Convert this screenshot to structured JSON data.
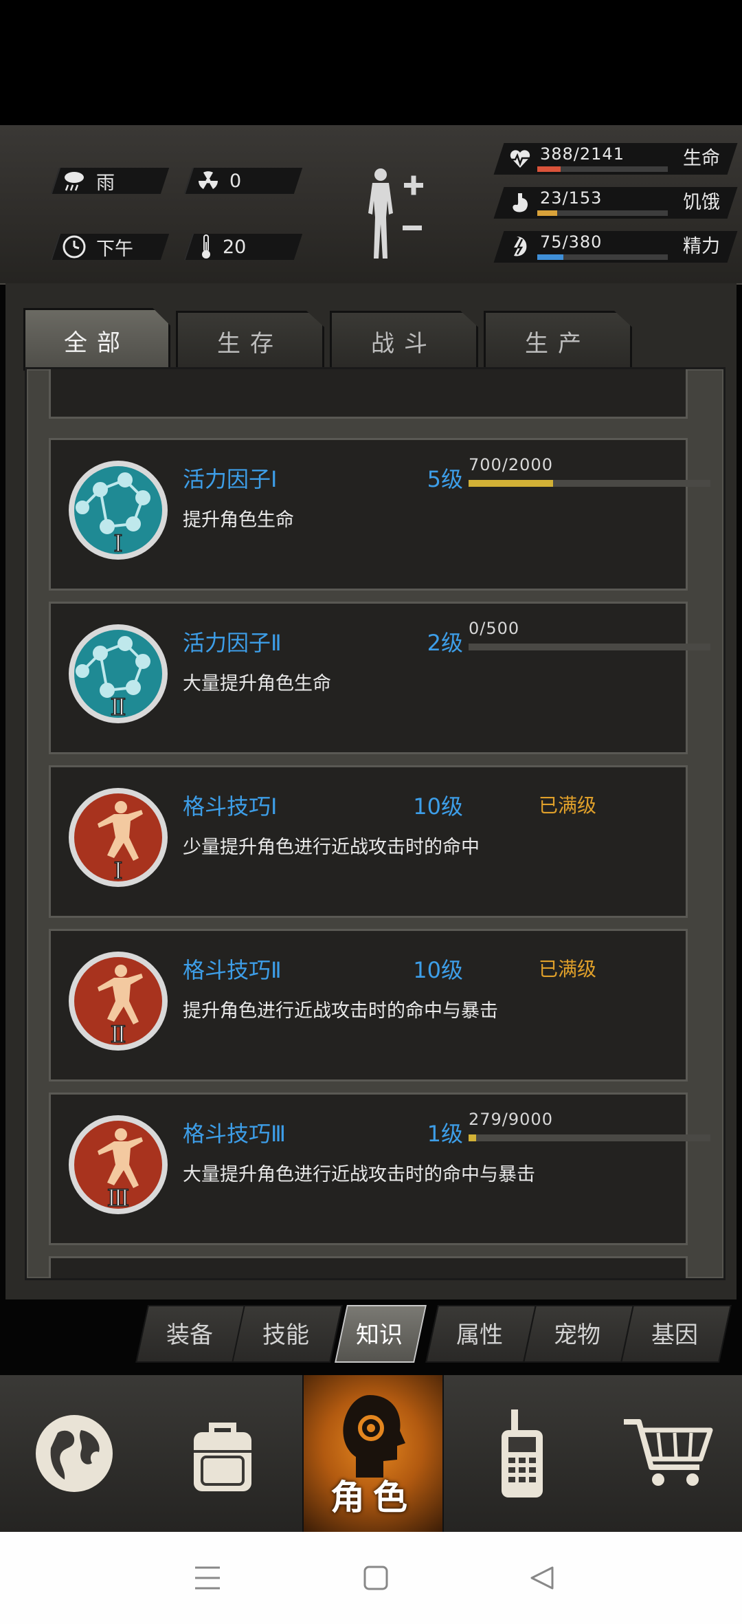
{
  "hud": {
    "weather": "雨",
    "radiation": "0",
    "time_of_day": "下午",
    "temperature": "20",
    "stats": [
      {
        "value": "388/2141",
        "label": "生命",
        "fill": 0.18,
        "color": "#d9533a",
        "icon": "heart-icon"
      },
      {
        "value": "23/153",
        "label": "饥饿",
        "fill": 0.15,
        "color": "#d9a23a",
        "icon": "stomach-icon"
      },
      {
        "value": "75/380",
        "label": "精力",
        "fill": 0.2,
        "color": "#3f8fd8",
        "icon": "energy-icon"
      }
    ]
  },
  "tabs": [
    {
      "label": "全部",
      "active": true
    },
    {
      "label": "生存",
      "active": false
    },
    {
      "label": "战斗",
      "active": false
    },
    {
      "label": "生产",
      "active": false
    }
  ],
  "cards": [
    {
      "name": "活力因子Ⅰ",
      "level": "5级",
      "progress": "700/2000",
      "fill": 0.35,
      "maxed": "",
      "desc": "提升角色生命",
      "icon": "molecule-icon",
      "numeral": "Ⅰ"
    },
    {
      "name": "活力因子Ⅱ",
      "level": "2级",
      "progress": "0/500",
      "fill": 0.0,
      "maxed": "",
      "desc": "大量提升角色生命",
      "icon": "molecule-icon",
      "numeral": "Ⅱ"
    },
    {
      "name": "格斗技巧Ⅰ",
      "level": "10级",
      "progress": "",
      "fill": null,
      "maxed": "已满级",
      "desc": "少量提升角色进行近战攻击时的命中",
      "icon": "martial-arts-icon",
      "numeral": "Ⅰ"
    },
    {
      "name": "格斗技巧Ⅱ",
      "level": "10级",
      "progress": "",
      "fill": null,
      "maxed": "已满级",
      "desc": "提升角色进行近战攻击时的命中与暴击",
      "icon": "martial-arts-icon",
      "numeral": "Ⅱ"
    },
    {
      "name": "格斗技巧Ⅲ",
      "level": "1级",
      "progress": "279/9000",
      "fill": 0.03,
      "maxed": "",
      "desc": "大量提升角色进行近战攻击时的命中与暴击",
      "icon": "martial-arts-icon",
      "numeral": "Ⅲ"
    }
  ],
  "subnav": [
    {
      "label": "装备",
      "active": false
    },
    {
      "label": "技能",
      "active": false
    },
    {
      "label": "知识",
      "active": true
    },
    {
      "label": "属性",
      "active": false
    },
    {
      "label": "宠物",
      "active": false
    },
    {
      "label": "基因",
      "active": false
    }
  ],
  "mainnav": {
    "active_label": "角色",
    "items": [
      "globe-icon",
      "backpack-icon",
      "character-icon",
      "radio-icon",
      "cart-icon"
    ]
  }
}
